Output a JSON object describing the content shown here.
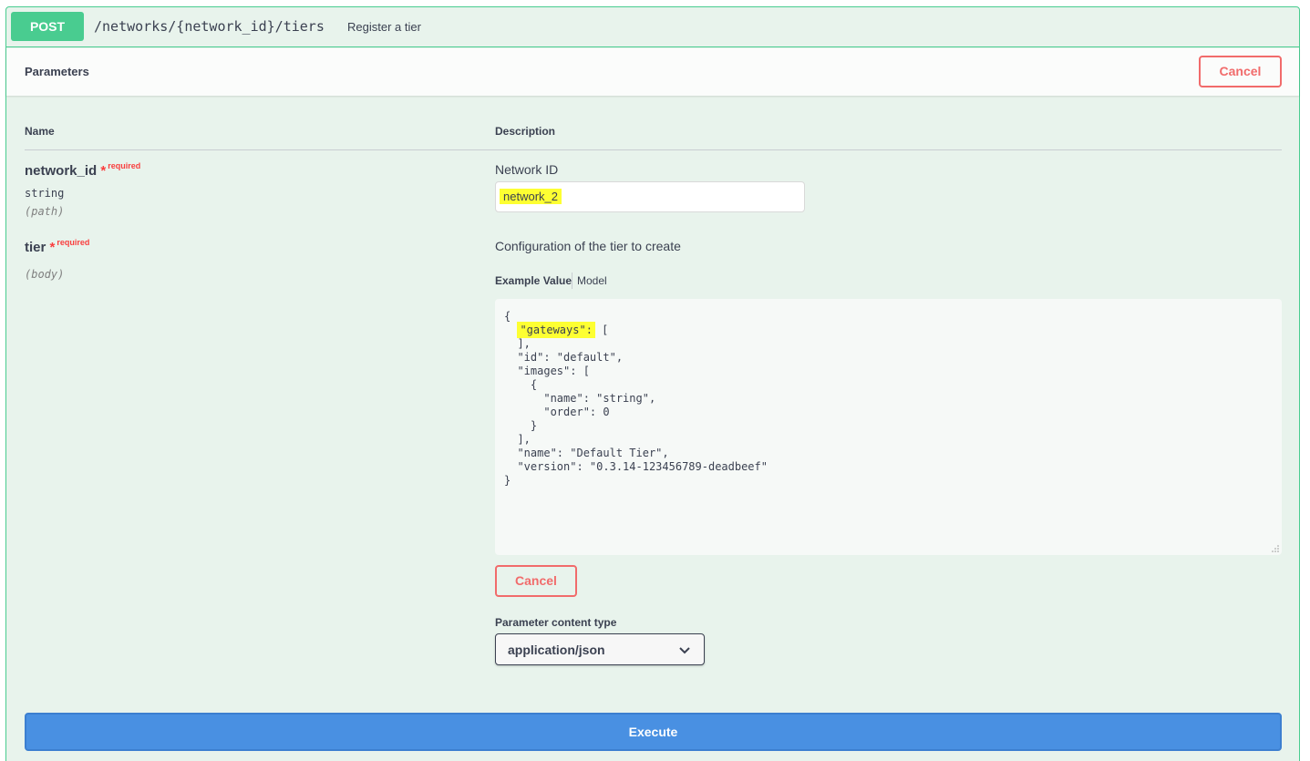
{
  "endpoint": {
    "method": "POST",
    "path": "/networks/{network_id}/tiers",
    "summary": "Register a tier"
  },
  "parameters_section": {
    "title": "Parameters",
    "cancel_label": "Cancel"
  },
  "columns": {
    "name": "Name",
    "description": "Description"
  },
  "params": [
    {
      "name": "network_id",
      "required_star": "*",
      "required_label": "required",
      "type": "string",
      "in": "(path)",
      "description": "Network ID",
      "value": "network_2"
    },
    {
      "name": "tier",
      "required_star": "*",
      "required_label": "required",
      "in": "(body)",
      "description": "Configuration of the tier to create"
    }
  ],
  "body_tabs": {
    "example": "Example Value",
    "model": "Model"
  },
  "code": {
    "l0": "{",
    "l1_key": "\"gateways\":",
    "l1_rest": " [",
    "l2": "  ],",
    "l3": "  \"id\": \"default\",",
    "l4": "  \"images\": [",
    "l5": "    {",
    "l6": "      \"name\": \"string\",",
    "l7": "      \"order\": 0",
    "l8": "    }",
    "l9": "  ],",
    "l10": "  \"name\": \"Default Tier\",",
    "l11": "  \"version\": \"0.3.14-123456789-deadbeef\"",
    "l12": "}"
  },
  "body_cancel_label": "Cancel",
  "content_type": {
    "label": "Parameter content type",
    "value": "application/json"
  },
  "execute_label": "Execute",
  "colors": {
    "post_green": "#49cc90",
    "panel_bg": "#e8f3ec",
    "cancel_red": "#f16b6b",
    "execute_blue": "#4990e2",
    "highlight_yellow": "#fdff32"
  }
}
